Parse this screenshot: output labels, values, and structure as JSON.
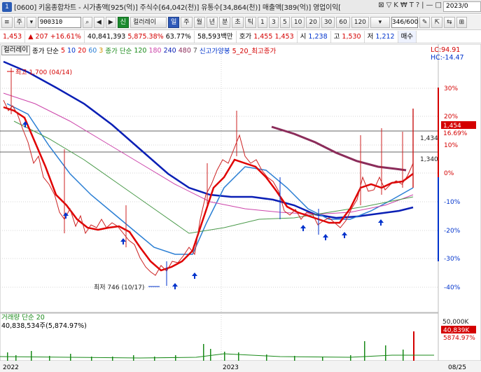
{
  "window": {
    "title": "[0600] 키움종합차트 - 시가총액[925(억)] 주식수[64,042(천)] 유통수[34,864(천)] 매출액[389(억)] 영업이익[",
    "tools": [
      "⊠",
      "▽",
      "K",
      "₩",
      "T",
      "?",
      "|",
      "—",
      "□"
    ],
    "date": "2023/0"
  },
  "toolbar": {
    "menu": "≡",
    "market": "주",
    "code": "900310",
    "search": "⌕",
    "prev": "◀",
    "next": "▶",
    "preset": "컬러레이",
    "preset_prefix": "신",
    "periods": [
      "일",
      "주",
      "월",
      "년",
      "분",
      "초",
      "틱"
    ],
    "active_period": "일",
    "ranges": [
      "1",
      "3",
      "5",
      "10",
      "20",
      "30",
      "60",
      "120"
    ],
    "counter": "346/600",
    "icons": [
      "✎",
      "⇱",
      "⇆",
      "⊞"
    ]
  },
  "quote": {
    "price": "1,453",
    "change_arrow": "▲",
    "change": "207",
    "change_pct": "+16.61%",
    "volume": "40,841,393",
    "volume_chg": "5,875.38%",
    "turnover": "63.77%",
    "amount": "58,593백만",
    "hoga_label": "호가",
    "hoga_ask": "1,455",
    "hoga_bid": "1,453",
    "open_label": "시",
    "open": "1,238",
    "high_label": "고",
    "high": "1,530",
    "low_label": "저",
    "low": "1,212",
    "buy_label": "매수"
  },
  "legend": {
    "name": "컬러레이",
    "ma_label": "종가 단순",
    "ma_periods": [
      "5",
      "10",
      "20",
      "60",
      "3"
    ],
    "ma2_label": "종가 단순",
    "ma2_periods": [
      "120",
      "180",
      "240",
      "480",
      "7"
    ],
    "new_high": "신고가양봉",
    "ma3": "5_20_최고종가"
  },
  "price_axis": {
    "lc": "LC:94.91",
    "hc": "HC:-14.47",
    "ticks": [
      "30%",
      "20%",
      "10%",
      "0%",
      "-10%",
      "-20%",
      "-30%",
      "-40%"
    ],
    "current_price": "1,454",
    "current_pct": "16.69%",
    "level_1": "1,434",
    "level_2": "1,340"
  },
  "annotations": {
    "high": "최고 1,700 (04/14)",
    "low": "최저 746 (10/17)"
  },
  "volume": {
    "title": "거래량 단순 20",
    "value": "40,838,534주(5,874.97%)",
    "axis_top": "50,000K",
    "axis_current": "40,839K",
    "axis_pct": "5874.97%"
  },
  "x_axis": {
    "labels": [
      "2022",
      "2023",
      "08/25"
    ]
  },
  "colors": {
    "up": "#d40000",
    "down": "#0033cc",
    "ma5": "#e00000",
    "ma20": "#2b7fd4",
    "ma120": "#0a1fb5",
    "trend": "#8b2c5a",
    "volume": "#1a8a1a"
  }
}
